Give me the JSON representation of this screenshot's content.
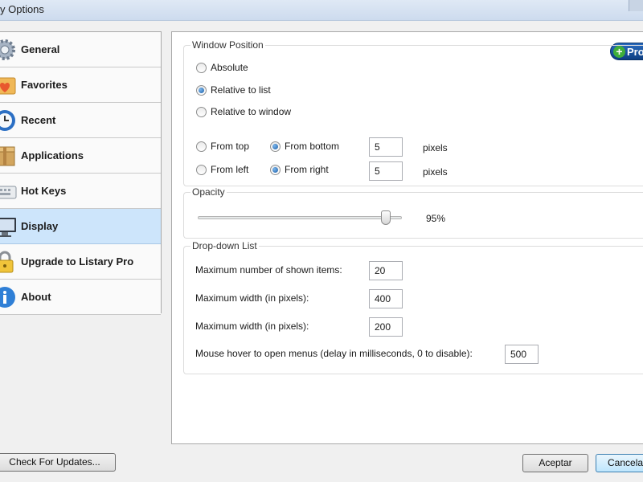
{
  "window": {
    "title": "y Options"
  },
  "sidebar": {
    "items": [
      {
        "label": "General",
        "icon": "gear-icon",
        "selected": false
      },
      {
        "label": "Favorites",
        "icon": "heart-folder-icon",
        "selected": false
      },
      {
        "label": "Recent",
        "icon": "clock-icon",
        "selected": false
      },
      {
        "label": "Applications",
        "icon": "box-icon",
        "selected": false
      },
      {
        "label": "Hot Keys",
        "icon": "keyboard-icon",
        "selected": false
      },
      {
        "label": "Display",
        "icon": "monitor-icon",
        "selected": true
      },
      {
        "label": "Upgrade to Listary Pro",
        "icon": "lock-icon",
        "selected": false
      },
      {
        "label": "About",
        "icon": "info-icon",
        "selected": false
      }
    ]
  },
  "window_position": {
    "title": "Window Position",
    "options": [
      {
        "label": "Absolute",
        "checked": false
      },
      {
        "label": "Relative to list",
        "checked": true
      },
      {
        "label": "Relative to window",
        "checked": false
      }
    ],
    "from_top": {
      "label": "From top",
      "checked": false
    },
    "from_bottom": {
      "label": "From bottom",
      "checked": true
    },
    "vertical_value": "5",
    "from_left": {
      "label": "From left",
      "checked": false
    },
    "from_right": {
      "label": "From right",
      "checked": true
    },
    "horizontal_value": "5",
    "unit": "pixels"
  },
  "pro_badge": {
    "label": "Pro"
  },
  "opacity": {
    "title": "Opacity",
    "value_text": "95%",
    "value": 0.95
  },
  "dropdown_list": {
    "title": "Drop-down List",
    "max_items_label": "Maximum number of shown items:",
    "max_items_value": "20",
    "max_width_label": "Maximum width (in pixels):",
    "max_width_value": "400",
    "max_width2_label": "Maximum width (in pixels):",
    "max_width2_value": "200",
    "hover_label": "Mouse hover to open menus (delay in milliseconds, 0 to disable):",
    "hover_value": "500"
  },
  "buttons": {
    "check_updates": "Check For Updates...",
    "accept": "Aceptar",
    "cancel": "Cancelar"
  },
  "colors": {
    "selected_nav": "#cde5fb",
    "pro_badge": "#1a5aaa",
    "pro_plus": "#3fae3a"
  }
}
